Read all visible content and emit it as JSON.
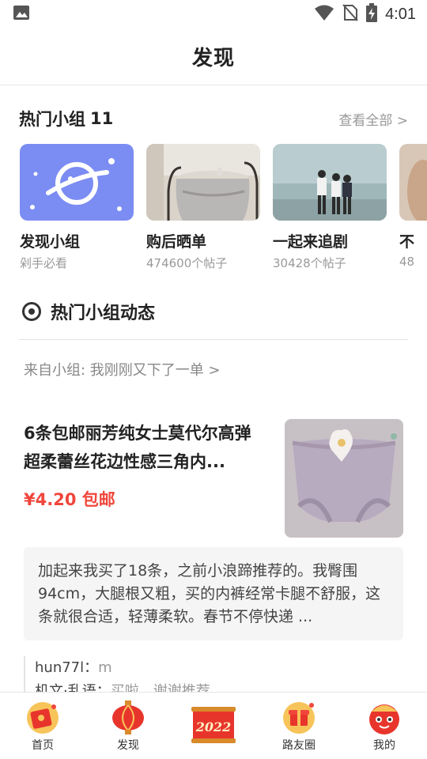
{
  "status_bar": {
    "time": "4:01",
    "icons": [
      "image-icon",
      "wifi-icon",
      "no-sim-icon",
      "battery-charging-icon"
    ]
  },
  "header": {
    "title": "发现"
  },
  "hot_groups": {
    "title": "热门小组",
    "count": "11",
    "see_all": "查看全部 >",
    "items": [
      {
        "name": "发现小组",
        "sub": "剁手必看"
      },
      {
        "name": "购后晒单",
        "sub": "474600个帖子"
      },
      {
        "name": "一起来追剧",
        "sub": "30428个帖子"
      },
      {
        "name": "不",
        "sub": "48"
      }
    ]
  },
  "dynamics": {
    "title": "热门小组动态",
    "from_group": "来自小组: 我刚刚又下了一单 >"
  },
  "post": {
    "product_title": "6条包邮丽芳纯女士莫代尔高弹超柔蕾丝花边性感三角内...",
    "price": "¥4.20 包邮",
    "comment": "加起来我买了18条，之前小浪蹄推荐的。我臀围94cm，大腿根又粗，买的内裤经常卡腿不舒服，这条就很合适，轻薄柔软。春节不停快递 ...",
    "replies": [
      {
        "user": "hun77l：",
        "text": "m"
      },
      {
        "user": "机文·乱语：",
        "text": "买啦，谢谢推荐"
      }
    ]
  },
  "tab_bar": {
    "items": [
      {
        "label": "首页",
        "icon": "home-redpacket-icon"
      },
      {
        "label": "发现",
        "icon": "discover-lantern-icon"
      },
      {
        "label": "",
        "icon": "new-year-2022-icon",
        "badge_text": "2022"
      },
      {
        "label": "路友圈",
        "icon": "circle-giftbox-icon"
      },
      {
        "label": "我的",
        "icon": "profile-mascot-icon"
      }
    ]
  },
  "colors": {
    "accent": "#f0463c",
    "group_purple": "#7b8cf2",
    "muted_text": "#999999"
  }
}
